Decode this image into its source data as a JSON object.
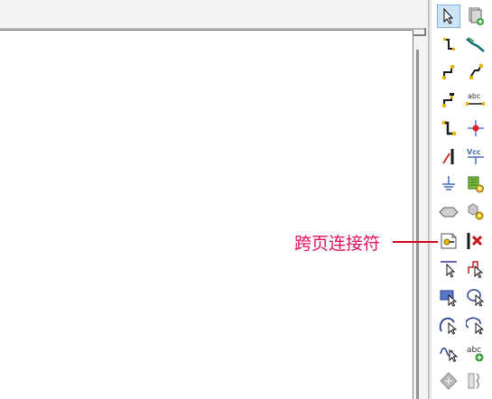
{
  "palette": {
    "tools": [
      {
        "name": "select-pointer-icon",
        "selected": true
      },
      {
        "name": "new-sheet-icon"
      },
      {
        "name": "wire-icon"
      },
      {
        "name": "bus-icon"
      },
      {
        "name": "wire-entry-icon"
      },
      {
        "name": "bus-entry-icon"
      },
      {
        "name": "junction-wire-icon"
      },
      {
        "name": "net-label-icon"
      },
      {
        "name": "wire-corner-icon"
      },
      {
        "name": "junction-dot-icon"
      },
      {
        "name": "angled-wire-icon"
      },
      {
        "name": "power-port-icon"
      },
      {
        "name": "ground-icon"
      },
      {
        "name": "place-part-icon"
      },
      {
        "name": "port-icon"
      },
      {
        "name": "off-page-gear-icon"
      },
      {
        "name": "off-page-connector-icon"
      },
      {
        "name": "no-connect-icon"
      },
      {
        "name": "line-tool-icon"
      },
      {
        "name": "polyline-tool-icon"
      },
      {
        "name": "rectangle-tool-icon"
      },
      {
        "name": "ellipse-tool-icon"
      },
      {
        "name": "arc-tool-icon"
      },
      {
        "name": "elliptical-arc-icon"
      },
      {
        "name": "bezier-tool-icon"
      },
      {
        "name": "text-tool-icon"
      },
      {
        "name": "diamond-tool-icon"
      },
      {
        "name": "ieee-symbol-icon"
      }
    ]
  },
  "callout": {
    "text": "跨页连接符"
  },
  "colors": {
    "callout_text": "#e0115f",
    "callout_line": "#d0021b",
    "selected_bg": "#cce4f7"
  }
}
